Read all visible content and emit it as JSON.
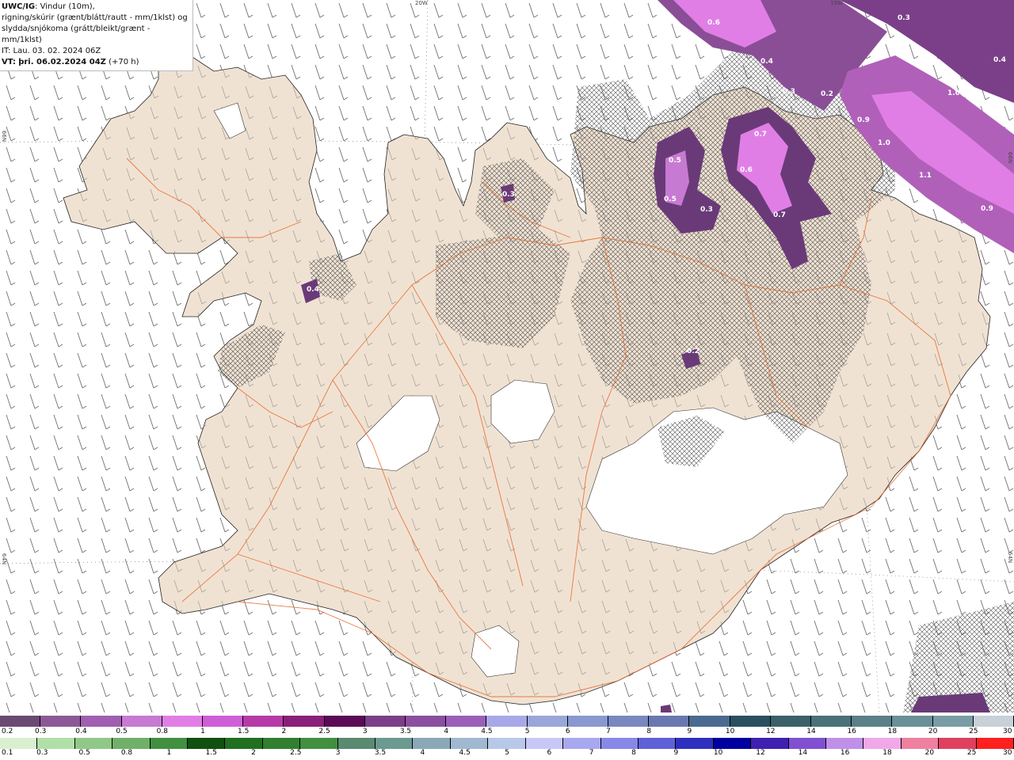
{
  "info": {
    "model": "UWC/IG",
    "line1": ": Vindur (10m),",
    "line2": "rigning/skúrir (grænt/blátt/rautt - mm/1klst) og",
    "line3": "slydda/snjókoma (grátt/bleikt/grænt - mm/1klst)",
    "it_line": "IT: Lau. 03. 02. 2024 06Z",
    "vt_label": "VT:",
    "vt_value": "þri. 06.02.2024 04Z",
    "vt_offset": "(+70 h)"
  },
  "coords": {
    "lon_20w": "20W",
    "lon_15w": "15W",
    "lat_66n_left": "66N",
    "lat_66n_right": "66N",
    "lat_64n_left": "64N",
    "lat_64n_right": "64N"
  },
  "contour_labels": [
    "0.6",
    "0.3",
    "0.4",
    "0.3",
    "0.2",
    "0.4",
    "1.0",
    "0.9",
    "1.0",
    "1.1",
    "0.9",
    "0.7",
    "0.5",
    "0.6",
    "0.5",
    "0.3",
    "0.7",
    "0.3",
    "0.4",
    "0.2"
  ],
  "legend_snow": {
    "colors": [
      "#6a4a72",
      "#8b5a96",
      "#a05fb0",
      "#c77ad2",
      "#e07ee6",
      "#cf5fd6",
      "#b53aa8",
      "#8a1f7a",
      "#5b0a55",
      "#7a3f88",
      "#8b4fa0",
      "#9a60b8",
      "#a8a8e8",
      "#9aa6d8",
      "#8a98d0",
      "#7a88c0",
      "#6a78b0",
      "#4a6a90",
      "#2a5060",
      "#3a6068",
      "#4a7078",
      "#5a8088",
      "#6a9098",
      "#7a9ca4",
      "#c8d0d8"
    ],
    "labels": [
      "0.2",
      "0.3",
      "0.4",
      "0.5",
      "0.8",
      "1",
      "1.5",
      "2",
      "2.5",
      "3",
      "3.5",
      "4",
      "4.5",
      "5",
      "6",
      "7",
      "8",
      "9",
      "10",
      "12",
      "14",
      "16",
      "18",
      "20",
      "25",
      "30"
    ]
  },
  "legend_rain": {
    "colors": [
      "#d8f0d0",
      "#b0e0a8",
      "#90c888",
      "#70b068",
      "#409040",
      "#105010",
      "#207020",
      "#308030",
      "#409040",
      "#5a8a70",
      "#6a9a90",
      "#8aa8b8",
      "#a0b8d0",
      "#b8c8e8",
      "#c8c8f8",
      "#a8a8f0",
      "#8888e8",
      "#6060d8",
      "#3030c0",
      "#0000a0",
      "#4020b0",
      "#8050d0",
      "#c090e8",
      "#f0a8e8",
      "#f080a0",
      "#e04060",
      "#ff2020"
    ],
    "labels": [
      "0.1",
      "0.3",
      "0.5",
      "0.8",
      "1",
      "1.5",
      "2",
      "2.5",
      "3",
      "3.5",
      "4",
      "4.5",
      "5",
      "6",
      "7",
      "8",
      "9",
      "10",
      "12",
      "14",
      "16",
      "18",
      "20",
      "25",
      "30"
    ]
  },
  "colors": {
    "land": "#f0e2d2",
    "ocean": "#ffffff",
    "roads": "#e8662a",
    "snow_light": "#b070b8",
    "snow_mid": "#9a4ea8",
    "snow_dark": "#6a3a78",
    "snow_pink": "#e07ee6",
    "hatch": "#555555",
    "glacier": "#ffffff"
  }
}
